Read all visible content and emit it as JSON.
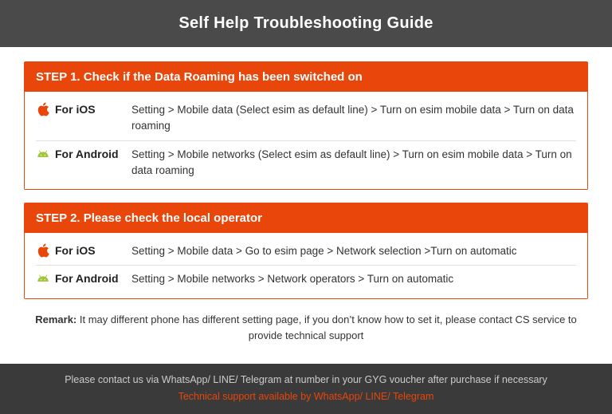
{
  "header": {
    "title": "Self Help Troubleshooting Guide"
  },
  "step1": {
    "title": "STEP 1.  Check if the Data Roaming has been switched on",
    "rows": [
      {
        "platform": "iOS",
        "label": "For iOS",
        "text": "Setting > Mobile data (Select esim as default line) > Turn on esim mobile data > Turn on data roaming"
      },
      {
        "platform": "Android",
        "label": "For Android",
        "text": "Setting > Mobile networks (Select esim as default line) > Turn on esim mobile data > Turn on data roaming"
      }
    ]
  },
  "step2": {
    "title": "STEP 2.  Please check the local operator",
    "rows": [
      {
        "platform": "iOS",
        "label": "For iOS",
        "text": "Setting > Mobile data > Go to esim page > Network selection >Turn on automatic"
      },
      {
        "platform": "Android",
        "label": "For Android",
        "text": "Setting > Mobile networks > Network operators > Turn on automatic"
      }
    ]
  },
  "remark": {
    "bold": "Remark:",
    "text": " It may different phone has different setting page, if you don’t know how to set it,  please contact CS service to provide technical support"
  },
  "footer": {
    "line1": "Please contact us via WhatsApp/ LINE/ Telegram at number in your GYG voucher after purchase if necessary",
    "line2": "Technical support available by WhatsApp/ LINE/ Telegram"
  }
}
